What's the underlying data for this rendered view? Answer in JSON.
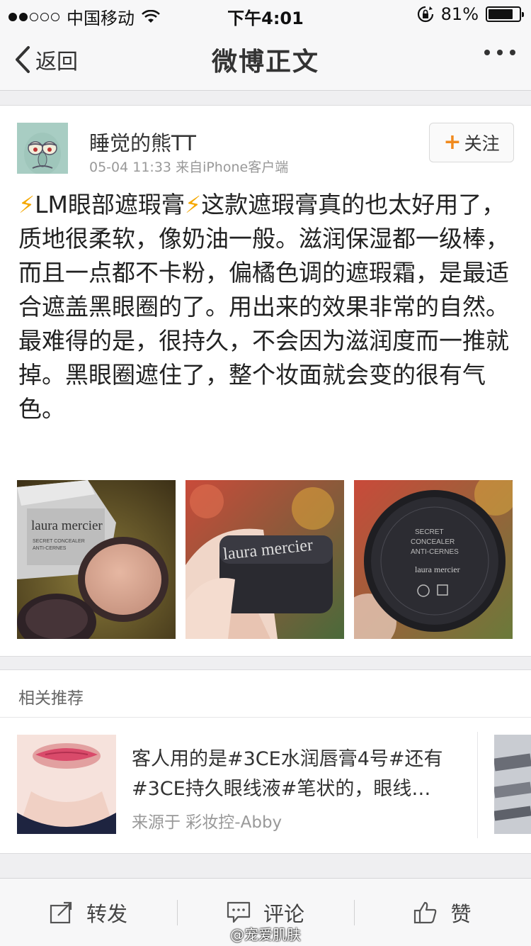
{
  "status_bar": {
    "carrier": "中国移动",
    "time": "下午4:01",
    "battery_text": "81%",
    "battery_level": 0.81,
    "signal_bars_filled": 2,
    "signal_bars_total": 5
  },
  "nav": {
    "back_label": "返回",
    "title": "微博正文"
  },
  "post": {
    "username": "睡觉的熊TT",
    "time": "05-04 11:33",
    "source": "来自iPhone客户端",
    "follow_label": "关注",
    "bolt_symbol": "⚡",
    "text_title": "LM眼部遮瑕膏",
    "text_body": "这款遮瑕膏真的也太好用了，质地很柔软，像奶油一般。滋润保湿都一级棒，而且一点都不卡粉，偏橘色调的遮瑕霜，是最适合遮盖黑眼圈的了。用出来的效果非常的自然。最难得的是，很持久，不会因为滋润度而一推就掉。黑眼圈遮住了，整个妆面就会变的很有气色。",
    "photos": [
      {
        "brand": "laura mercier",
        "sub": "SECRET CONCEALER",
        "sub2": "ANTI-CERNES"
      },
      {
        "brand": "laura mercier"
      },
      {
        "brand": "laura mercier",
        "sub": "SECRET",
        "sub2": "CONCEALER",
        "sub3": "ANTI-CERNES"
      }
    ]
  },
  "related": {
    "header": "相关推荐",
    "item_text": "客人用的是#3CE水润唇膏4号#还有#3CE持久眼线液#笔状的，眼线…",
    "item_source": "来源于 彩妆控-Abby"
  },
  "toolbar": {
    "repost_label": "转发",
    "comment_label": "评论",
    "like_label": "赞"
  },
  "watermark": "@宠爱肌肤",
  "colors": {
    "accent_orange": "#f08a1e",
    "bolt_yellow": "#f5a800",
    "meta_gray": "#999999"
  }
}
